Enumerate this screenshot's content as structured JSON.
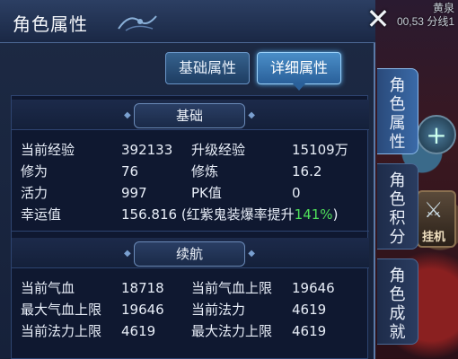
{
  "server": {
    "name": "黄泉",
    "line": "00,53 分线1"
  },
  "window": {
    "title": "角色属性",
    "close_label": "✕"
  },
  "top_tabs": [
    {
      "label": "基础属性",
      "active": false
    },
    {
      "label": "详细属性",
      "active": true
    }
  ],
  "side_tabs": [
    {
      "label": "角色属性",
      "active": true
    },
    {
      "label": "角色积分",
      "active": false
    },
    {
      "label": "角色成就",
      "active": false
    }
  ],
  "side_buttons": {
    "plus": "+",
    "auto_label": "挂机"
  },
  "basic": {
    "header": "基础",
    "rows": [
      {
        "k1": "当前经验",
        "v1": "392133",
        "k2": "升级经验",
        "v2": "15109万"
      },
      {
        "k1": "修为",
        "v1": "76",
        "k2": "修炼",
        "v2": "16.2"
      },
      {
        "k1": "活力",
        "v1": "997",
        "k2": "PK值",
        "v2": "0"
      }
    ],
    "luck": {
      "label": "幸运值",
      "value": "156.816",
      "note_prefix": "(红紫鬼装爆率提升",
      "note_percent": "141%",
      "note_suffix": ")"
    }
  },
  "endurance": {
    "header": "续航",
    "rows": [
      {
        "k1": "当前气血",
        "v1": "18718",
        "k2": "当前气血上限",
        "v2": "19646"
      },
      {
        "k1": "最大气血上限",
        "v1": "19646",
        "k2": "当前法力",
        "v2": "4619"
      },
      {
        "k1": "当前法力上限",
        "v1": "4619",
        "k2": "最大法力上限",
        "v2": "4619"
      }
    ]
  },
  "colors": {
    "accent_green": "#4ee05a",
    "panel_bg": "#16213a",
    "active_tab": "#4a8ec8"
  }
}
